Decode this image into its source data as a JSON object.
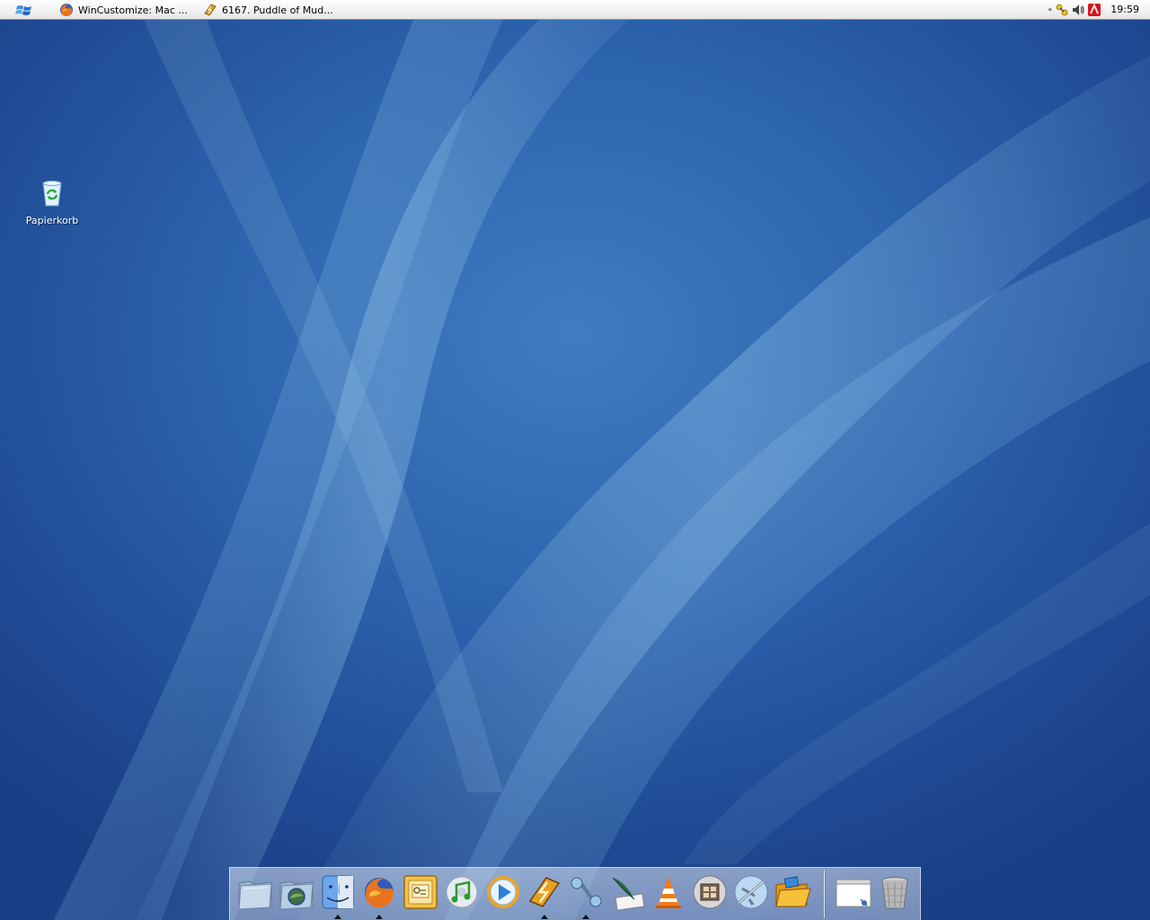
{
  "taskbar": {
    "start_icon": "windows-flag-icon",
    "tasks": [
      {
        "label": "WinCustomize: Mac ...",
        "icon": "firefox-icon"
      },
      {
        "label": "6167. Puddle of Mud...",
        "icon": "winamp-icon"
      }
    ],
    "tray": {
      "expand_icon": "tray-expand-arrow-icon",
      "icons": [
        "network-icon",
        "volume-icon",
        "antivirus-icon"
      ],
      "clock": "19:59"
    }
  },
  "desktop": {
    "icons": [
      {
        "label": "Papierkorb",
        "icon": "recycle-bin-icon"
      }
    ]
  },
  "dock": {
    "items": [
      {
        "name": "documents-folder-icon",
        "running": false
      },
      {
        "name": "pictures-folder-icon",
        "running": false
      },
      {
        "name": "finder-icon",
        "running": true
      },
      {
        "name": "firefox-icon",
        "running": true
      },
      {
        "name": "outlook-icon",
        "running": false
      },
      {
        "name": "itunes-icon",
        "running": false
      },
      {
        "name": "quicktime-icon",
        "running": false
      },
      {
        "name": "winamp-icon",
        "running": true
      },
      {
        "name": "messenger-icon",
        "running": true
      },
      {
        "name": "mail-quill-icon",
        "running": false
      },
      {
        "name": "vlc-icon",
        "running": false
      },
      {
        "name": "photo-booth-icon",
        "running": false
      },
      {
        "name": "safari-plane-icon",
        "running": false
      },
      {
        "name": "open-folder-icon",
        "running": false
      },
      {
        "name": "window-preview-icon",
        "running": false
      },
      {
        "name": "trash-icon",
        "running": false
      }
    ]
  }
}
